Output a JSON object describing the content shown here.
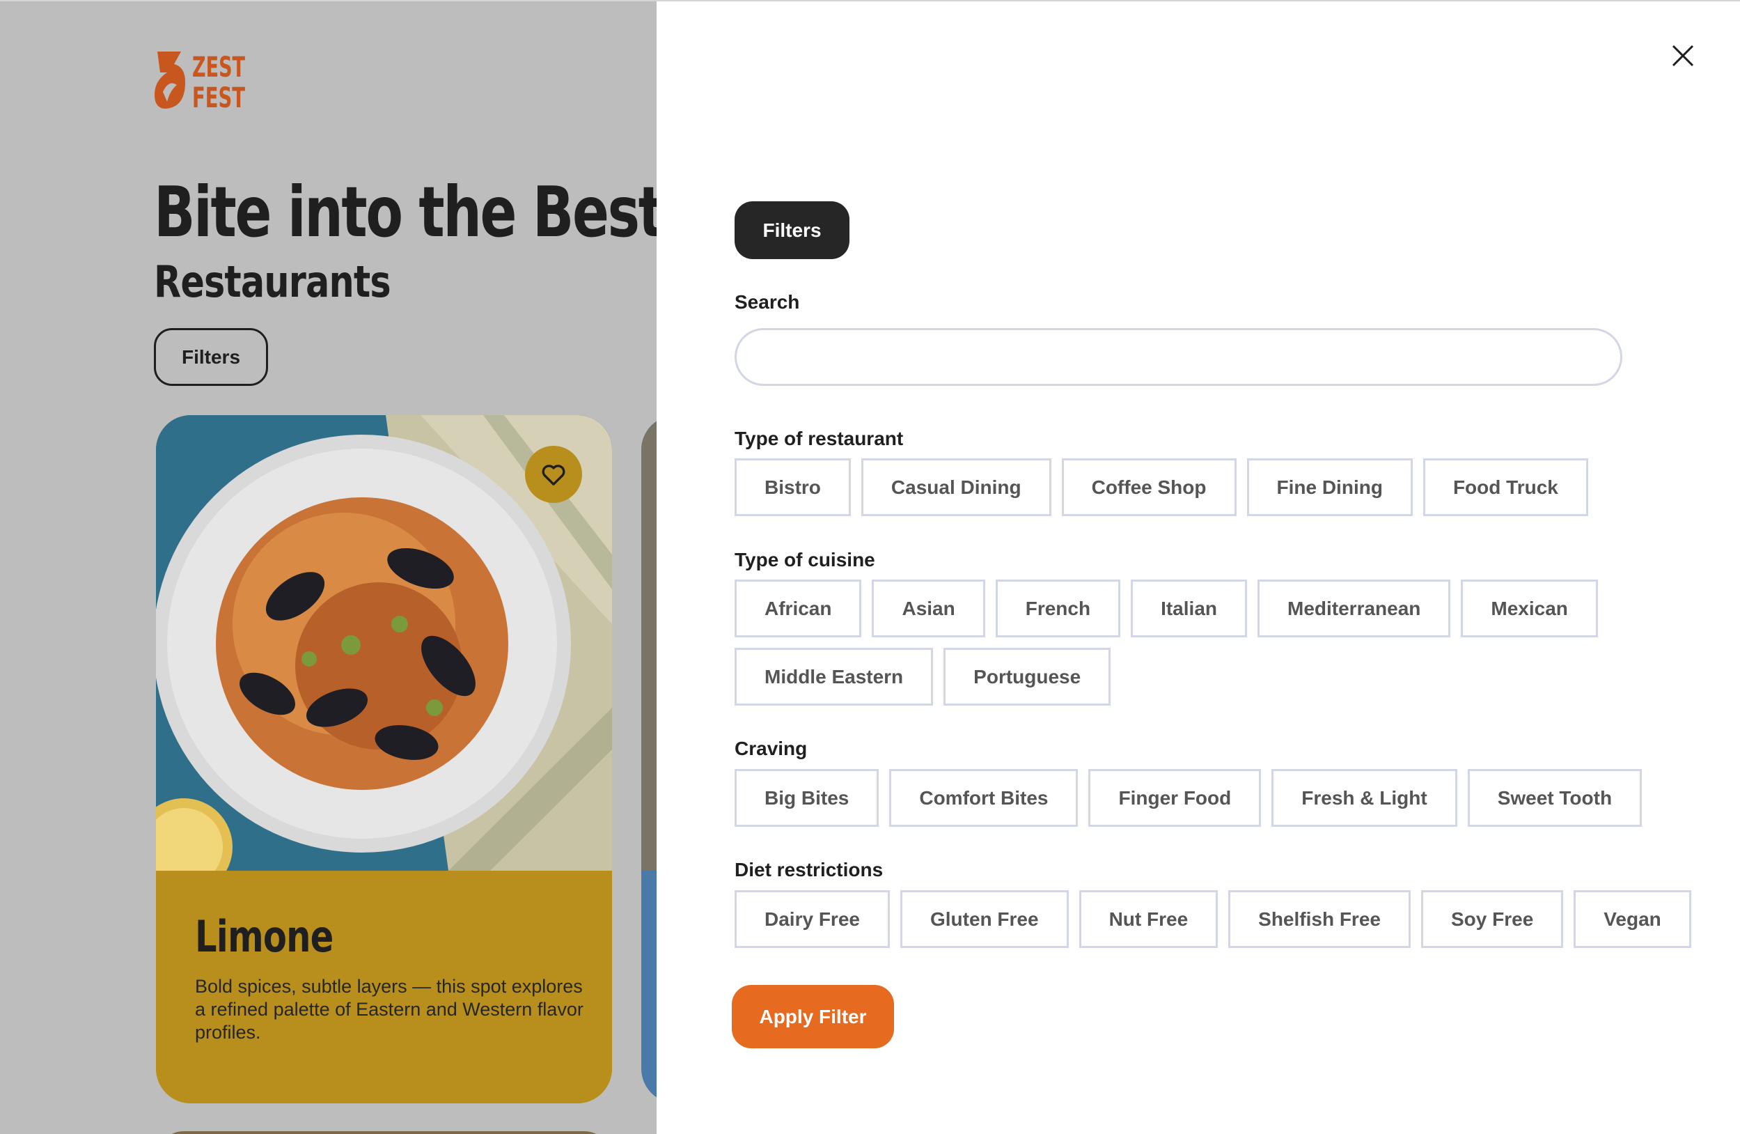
{
  "brand": {
    "logo_line1": "ZEST",
    "logo_line2": "FEST",
    "color": "#c8561f"
  },
  "page": {
    "title": "Bite into the Best",
    "subtitle": "Restaurants",
    "filters_label": "Filters"
  },
  "cards": [
    {
      "name": "Limone",
      "description": "Bold spices, subtle layers — this spot explores a refined palette of Eastern and Western flavor profiles.",
      "color": "#b88f1c"
    }
  ],
  "drawer": {
    "tag_label": "Filters",
    "search": {
      "label": "Search",
      "value": "",
      "placeholder": ""
    },
    "restaurant_type": {
      "label": "Type of restaurant",
      "options": [
        "Bistro",
        "Casual Dining",
        "Coffee Shop",
        "Fine Dining",
        "Food Truck"
      ]
    },
    "cuisine": {
      "label": "Type of cuisine",
      "options_row1": [
        "African",
        "Asian",
        "French",
        "Italian",
        "Mediterranean",
        "Mexican"
      ],
      "options_row2": [
        "Middle Eastern",
        "Portuguese"
      ]
    },
    "craving": {
      "label": "Craving",
      "options": [
        "Big Bites",
        "Comfort Bites",
        "Finger Food",
        "Fresh & Light",
        "Sweet Tooth"
      ]
    },
    "diet": {
      "label": "Diet restrictions",
      "options": [
        "Dairy Free",
        "Gluten Free",
        "Nut Free",
        "Shelfish Free",
        "Soy Free",
        "Vegan"
      ]
    },
    "apply_label": "Apply Filter",
    "accent": "#e66a1f"
  },
  "icons": [
    "logo-icon",
    "heart-icon",
    "close-icon"
  ]
}
